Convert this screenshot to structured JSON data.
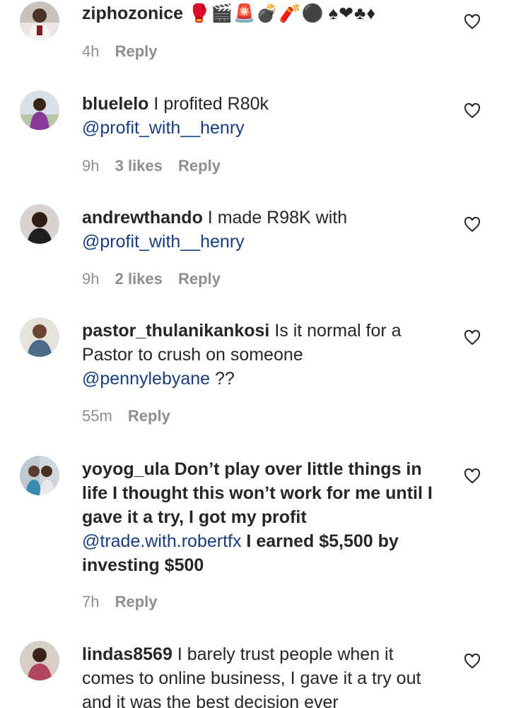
{
  "comments": [
    {
      "user": "ziphozonice",
      "text": "🥊🎬🚨💣🧨⚫ ♠❤♣♦",
      "time": "4h",
      "likes": "",
      "reply": "Reply"
    },
    {
      "user": "bluelelo",
      "text": "I profited R80k",
      "mention": "@profit_with__henry",
      "time": "9h",
      "likes": "3 likes",
      "reply": "Reply"
    },
    {
      "user": "andrewthando",
      "text": "I made R98K with",
      "mention": "@profit_with__henry",
      "time": "9h",
      "likes": "2 likes",
      "reply": "Reply"
    },
    {
      "user": "pastor_thulanikankosi",
      "text": "Is it normal for a Pastor to crush on someone",
      "mention": "@pennylebyane",
      "after": "??",
      "time": "55m",
      "likes": "",
      "reply": "Reply"
    },
    {
      "user": "yoyog_ula",
      "text": "Don’t play over little things in life I thought this won’t work for me until I gave it a try, I got my profit",
      "mention": "@trade.with.robertfx",
      "after": "I earned $5,500 by investing $500",
      "time": "7h",
      "likes": "",
      "reply": "Reply"
    },
    {
      "user": "lindas8569",
      "text": "I barely trust people when it comes to online business, I gave it a try out and it was the best decision ever",
      "time": "",
      "likes": "",
      "reply": ""
    }
  ]
}
